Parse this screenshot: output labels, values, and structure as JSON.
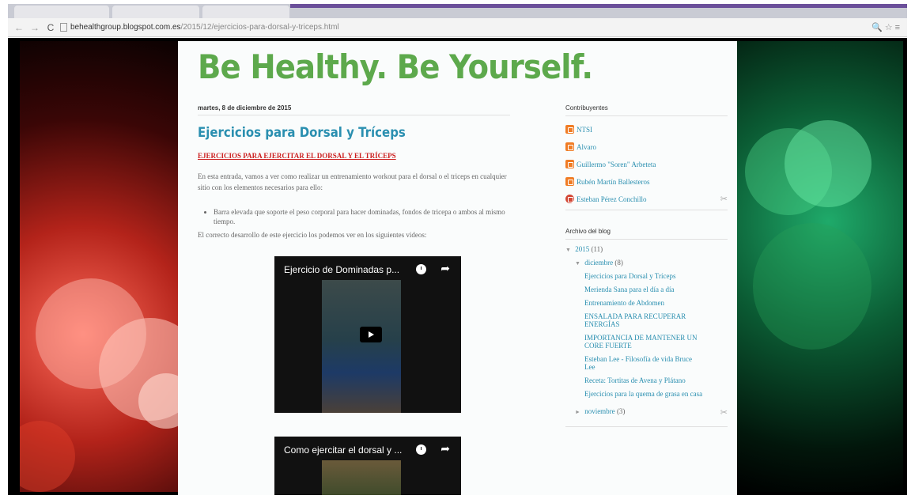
{
  "browser": {
    "url_host": "behealthgroup.blogspot.com.es",
    "url_path": "/2015/12/ejercicios-para-dorsal-y-triceps.html",
    "back_icon": "back-arrow-icon",
    "forward_icon": "forward-arrow-icon",
    "reload_icon": "reload-icon",
    "back_glyph": "←",
    "forward_glyph": "→",
    "reload_glyph": "C",
    "right_icons": "🔍☆≡"
  },
  "blog": {
    "title": "Be Healthy. Be Yourself.",
    "title_color": "#5da94c"
  },
  "post": {
    "date": "martes, 8 de diciembre de 2015",
    "title": "Ejercicios para Dorsal y Tríceps",
    "subtitle": "EJERCICIOS PARA EJERCITAR EL DORSAL Y EL TRÍCEPS",
    "intro": "En esta entrada, vamos a ver como realizar un entrenamiento workout para el dorsal o el triceps en cualquier sitio con los elementos necesarios para ello:",
    "list": [
      "Barra elevada que soporte el peso corporal para hacer dominadas, fondos de tricepa o ambos al mismo tiempo."
    ],
    "videos_intro": "El correcto desarrollo de este ejercicio los podemos ver en los siguientes videos:",
    "videos": [
      {
        "title": "Ejercicio de Dominadas p..."
      },
      {
        "title": "Como ejercitar el dorsal y ..."
      }
    ]
  },
  "sidebar": {
    "contributors_title": "Contribuyentes",
    "contributors": [
      {
        "name": "NTSI",
        "icon": "blogger-icon"
      },
      {
        "name": "Alvaro",
        "icon": "blogger-icon"
      },
      {
        "name": "Guillermo \"Soren\" Arbeteta",
        "icon": "blogger-icon"
      },
      {
        "name": "Rubén Martín Ballesteros",
        "icon": "blogger-icon"
      },
      {
        "name": "Esteban Pérez Conchillo",
        "icon": "google-plus-icon"
      }
    ],
    "archive_title": "Archivo del blog",
    "archive": {
      "year": "2015",
      "year_count": "(11)",
      "month": "diciembre",
      "month_count": "(8)",
      "posts": [
        "Ejercicios para Dorsal y Tríceps",
        "Merienda Sana para el día a día",
        "Entrenamiento de Abdomen",
        "ENSALADA PARA RECUPERAR ENERGÍAS",
        "IMPORTANCIA DE MANTENER UN CORE FUERTE",
        "Esteban Lee - Filosofía de vida Bruce Lee",
        "Receta: Tortitas de Avena y Plátano",
        "Ejercicios para la quema de grasa en casa"
      ],
      "prev_month": "noviembre",
      "prev_month_count": "(3)"
    }
  }
}
